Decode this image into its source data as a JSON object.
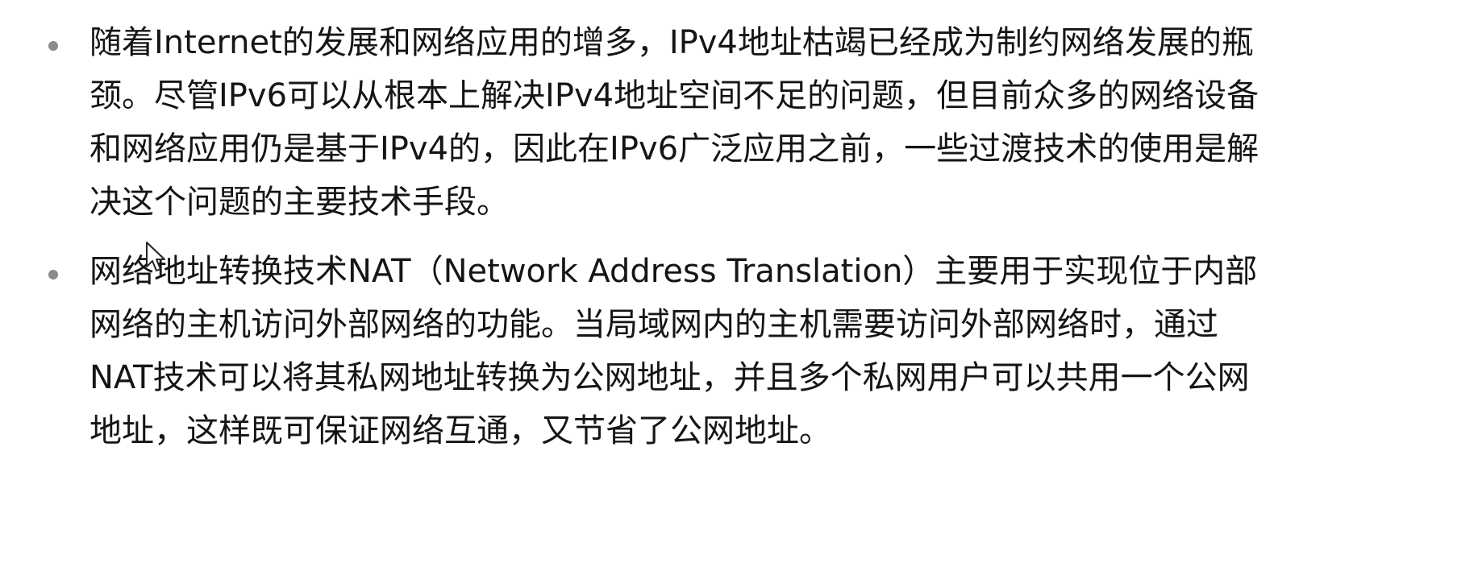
{
  "bullets": [
    {
      "lines": [
        "随着Internet的发展和网络应用的增多，IPv4地址枯竭已经成为制约网络发展的瓶",
        "颈。尽管IPv6可以从根本上解决IPv4地址空间不足的问题，但目前众多的网络设备",
        "和网络应用仍是基于IPv4的，因此在IPv6广泛应用之前，一些过渡技术的使用是解",
        "决这个问题的主要技术手段。"
      ]
    },
    {
      "lines": [
        "网络地址转换技术NAT（Network Address Translation）主要用于实现位于内部",
        "网络的主机访问外部网络的功能。当局域网内的主机需要访问外部网络时，通过",
        "NAT技术可以将其私网地址转换为公网地址，并且多个私网用户可以共用一个公网",
        "地址，这样既可保证网络互通，又节省了公网地址。"
      ]
    }
  ],
  "icons": {
    "cursor": "mouse-pointer-icon"
  }
}
